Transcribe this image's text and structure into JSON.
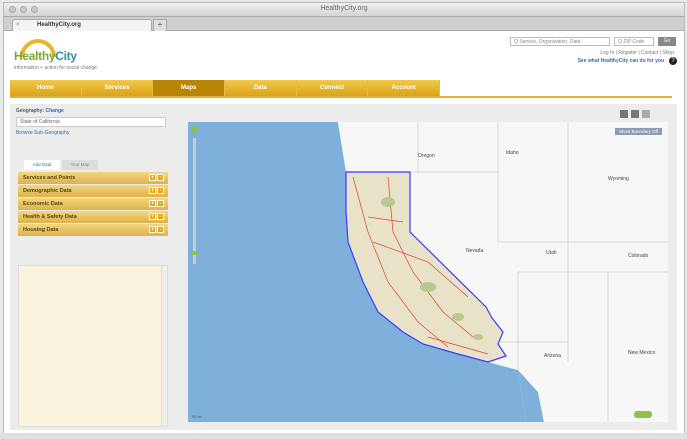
{
  "window": {
    "title": "HealthyCity.org"
  },
  "tab": {
    "label": "HealthyCity.org"
  },
  "header": {
    "logo_healthy": "Healthy",
    "logo_city": "City",
    "tagline": "information + action for social change",
    "search_placeholder": "Q Service, Organization, Data",
    "zip_placeholder": "Q ZIP Code",
    "go_label": "Go",
    "toplinks": "Log In | Register | Contact | Shop",
    "whats_see": "See what HealthyCity can do for you",
    "help_label": "?"
  },
  "nav": {
    "items": [
      "Home",
      "Services",
      "Maps",
      "Data",
      "Connect",
      "Account"
    ],
    "active": "Maps"
  },
  "left": {
    "geo_label": "Geography: ",
    "geo_change": "Change",
    "geo_value": "State of California",
    "geo_link": "Browse Sub-Geography",
    "tabs": [
      "Add Data",
      "Your Map"
    ],
    "accordion": [
      "Services and Points",
      "Demographic Data",
      "Economic Data",
      "Health & Safety Data",
      "Housing Data"
    ],
    "plus": "+",
    "minus": "-"
  },
  "map": {
    "basemap_label": "Show Boundary Off",
    "tool_icons": [
      "print-icon",
      "save-icon",
      "share-icon"
    ],
    "scale_text": "50 mi",
    "state_labels": [
      "Oregon",
      "Idaho",
      "Wyoming",
      "Nevada",
      "Utah",
      "Colorado",
      "Arizona",
      "New Mexico"
    ]
  }
}
